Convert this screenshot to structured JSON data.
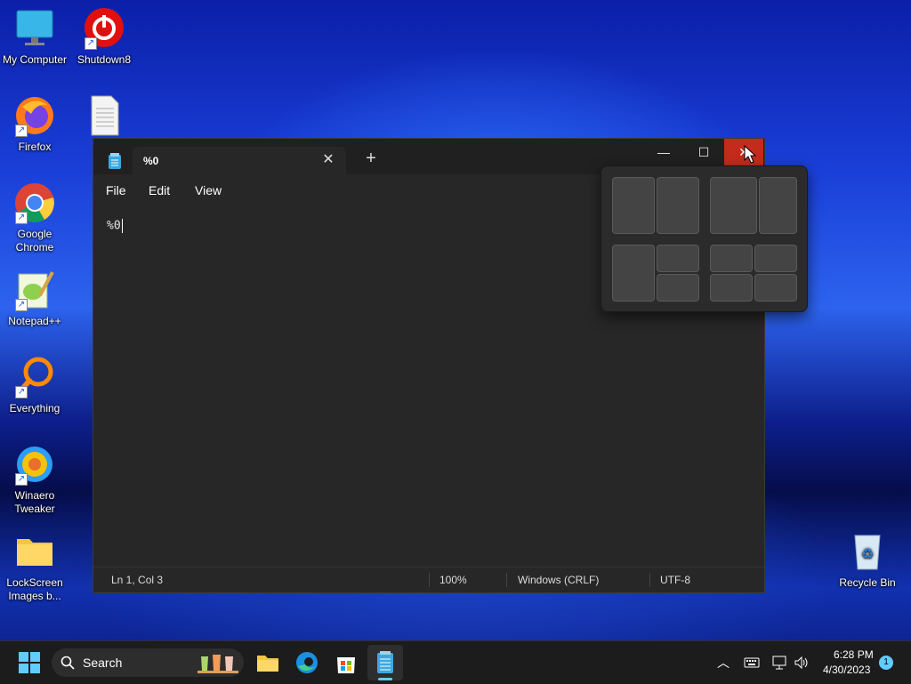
{
  "desktop": {
    "icons": [
      {
        "label": "My Computer"
      },
      {
        "label": "Shutdown8"
      },
      {
        "label": "Firefox"
      },
      {
        "label": "Google Chrome"
      },
      {
        "label": "Notepad++"
      },
      {
        "label": "Everything"
      },
      {
        "label": "Winaero Tweaker"
      },
      {
        "label": "LockScreen Images b..."
      },
      {
        "label": "Recycle Bin"
      }
    ]
  },
  "notepad": {
    "tab_title": "%0",
    "menu": [
      "File",
      "Edit",
      "View"
    ],
    "content": "%0",
    "status": {
      "position": "Ln 1, Col 3",
      "zoom": "100%",
      "line_ending": "Windows (CRLF)",
      "encoding": "UTF-8"
    }
  },
  "taskbar": {
    "search_label": "Search",
    "time": "6:28 PM",
    "date": "4/30/2023",
    "notification_count": "1"
  },
  "colors": {
    "close_hover": "#c42b1c",
    "accent": "#60cdff"
  }
}
